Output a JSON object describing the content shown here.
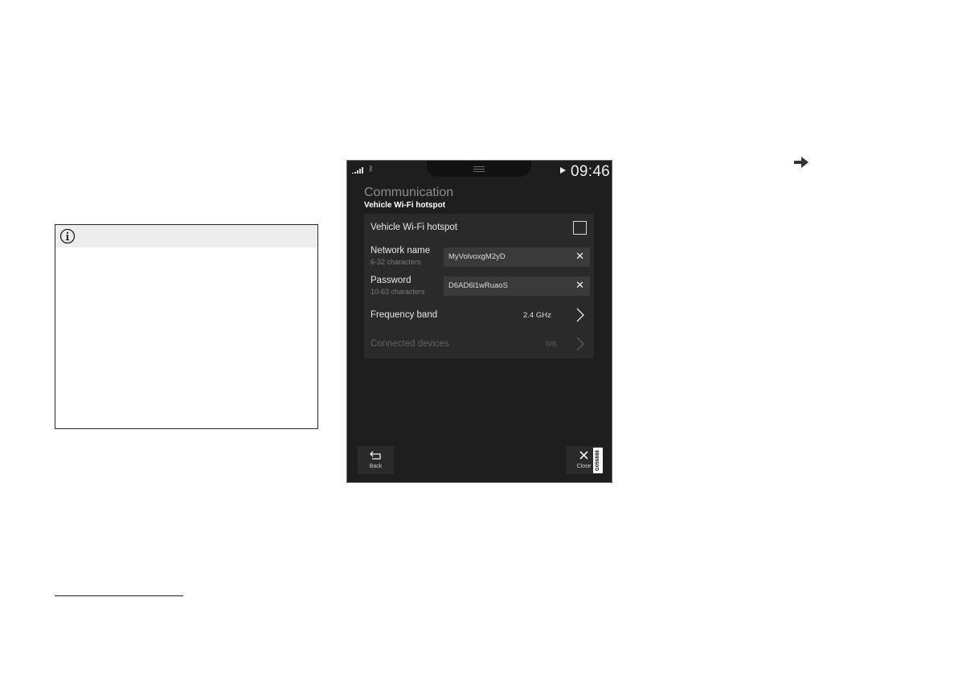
{
  "screen": {
    "status_bar": {
      "time": "09:46"
    },
    "header": {
      "title": "Communication",
      "subtitle": "Vehicle Wi-Fi hotspot"
    },
    "settings": {
      "hotspot_toggle": {
        "label": "Vehicle Wi-Fi hotspot",
        "checked": false
      },
      "network_name": {
        "label": "Network name",
        "hint": "6-32 characters",
        "value": "MyVolvoxgM2yD"
      },
      "password": {
        "label": "Password",
        "hint": "10-63 characters",
        "value": "D6AD6l1wRuaoS"
      },
      "frequency_band": {
        "label": "Frequency band",
        "value": "2.4 GHz"
      },
      "connected_devices": {
        "label": "Connected devices",
        "value": "0/8",
        "enabled": false
      }
    },
    "bottom_bar": {
      "back_label": "Back",
      "close_label": "Close"
    },
    "image_code": "G056888"
  },
  "colors": {
    "screen_bg": "#1e1e1e",
    "panel_bg": "#2a2a2a",
    "field_bg": "#3a3a3a",
    "note_header": "#ededed"
  },
  "icons": [
    "info-icon",
    "arrow-right-icon",
    "signal-icon",
    "bluetooth-icon",
    "play-icon",
    "clear-icon",
    "chevron-right-icon",
    "back-icon",
    "close-icon"
  ]
}
